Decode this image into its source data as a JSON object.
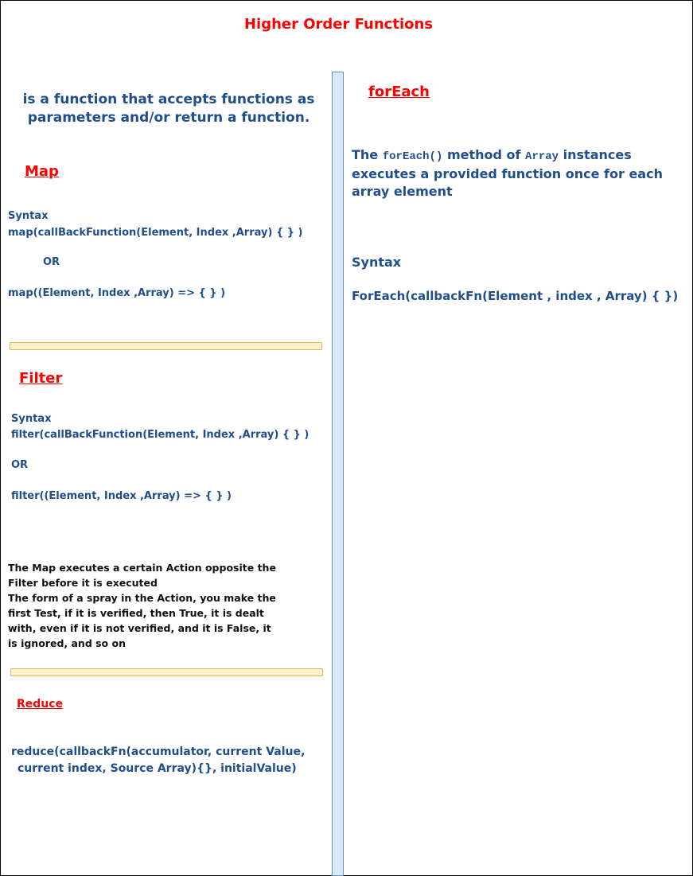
{
  "title": "Higher Order Functions",
  "left": {
    "definition": [
      "is a function that accepts functions as",
      "parameters and/or return a function."
    ],
    "map": {
      "heading": "Map",
      "syntax_label": "Syntax",
      "syntax_1": "map(callBackFunction(Element, Index ,Array) { } )",
      "or_label": "OR",
      "syntax_2": "map((Element, Index ,Array) => { } )"
    },
    "filter": {
      "heading": "Filter",
      "syntax_label": "Syntax",
      "syntax_1": "filter(callBackFunction(Element, Index ,Array) { } )",
      "or_label": "OR",
      "syntax_2": "filter((Element, Index ,Array) => { } )"
    },
    "note": [
      "The Map executes a certain Action opposite the",
      "Filter before it is executed",
      "The form of a spray in the Action, you make the",
      "first Test, if it is verified, then True, it is dealt",
      "with, even if it is not verified, and it is False, it",
      "is ignored, and so on"
    ],
    "reduce": {
      "heading": "Reduce",
      "syntax_line_1": "reduce(callbackFn(accumulator, current Value,",
      "syntax_line_2": "current index, Source Array){}, initialValue)"
    }
  },
  "right": {
    "heading": "forEach",
    "desc_the": "The",
    "desc_method_code": "forEach()",
    "desc_method_text": "method of",
    "desc_array_code": "Array",
    "desc_instances": "instances",
    "desc_line_2": "executes a provided function once for each",
    "desc_line_3": "array element",
    "syntax_label": "Syntax",
    "syntax": "ForEach(callbackFn(Element , index , Array) { })"
  },
  "colors": {
    "heading_red": "#ff0000",
    "text_blue": "#1f4e8c",
    "divider_fill": "#dae8fc",
    "divider_stroke": "#6c8ebf",
    "separator_fill": "#fff2cc",
    "separator_stroke": "#d6b656"
  }
}
